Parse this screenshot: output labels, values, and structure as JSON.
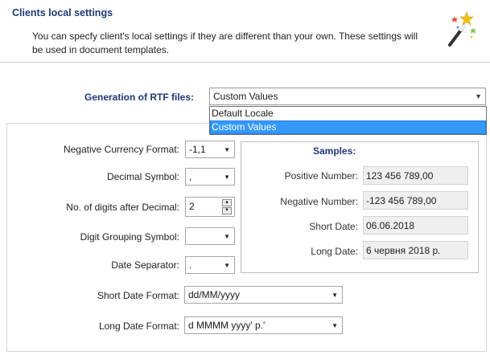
{
  "header": {
    "title": "Clients local settings",
    "description": "You can specfy client's local settings if they are different than your own. These settings will be used in document templates.",
    "icon": "magic-wand-icon"
  },
  "rtf": {
    "label": "Generation of RTF files:",
    "value": "Custom Values",
    "options": [
      "Default Locale",
      "Custom Values"
    ],
    "selected_index": 1
  },
  "fields": {
    "negative_currency_format": {
      "label": "Negative Currency Format:",
      "value": "-1,1"
    },
    "decimal_symbol": {
      "label": "Decimal Symbol:",
      "value": ","
    },
    "digits_after_decimal": {
      "label": "No. of digits after Decimal:",
      "value": "2"
    },
    "digit_grouping_symbol": {
      "label": "Digit Grouping Symbol:",
      "value": ""
    },
    "date_separator": {
      "label": "Date Separator:",
      "value": "."
    },
    "short_date_format": {
      "label": "Short Date Format:",
      "value": "dd/MM/yyyy"
    },
    "long_date_format": {
      "label": "Long Date Format:",
      "value": "d MMMM yyyy' р.'"
    }
  },
  "samples": {
    "title": "Samples:",
    "positive_number": {
      "label": "Positive Number:",
      "value": "123 456 789,00"
    },
    "negative_number": {
      "label": "Negative Number:",
      "value": "-123 456 789,00"
    },
    "short_date": {
      "label": "Short Date:",
      "value": "06.06.2018"
    },
    "long_date": {
      "label": "Long Date:",
      "value": "6 червня 2018 р."
    }
  },
  "colors": {
    "heading": "#1e3a78",
    "selection": "#3399ff"
  }
}
